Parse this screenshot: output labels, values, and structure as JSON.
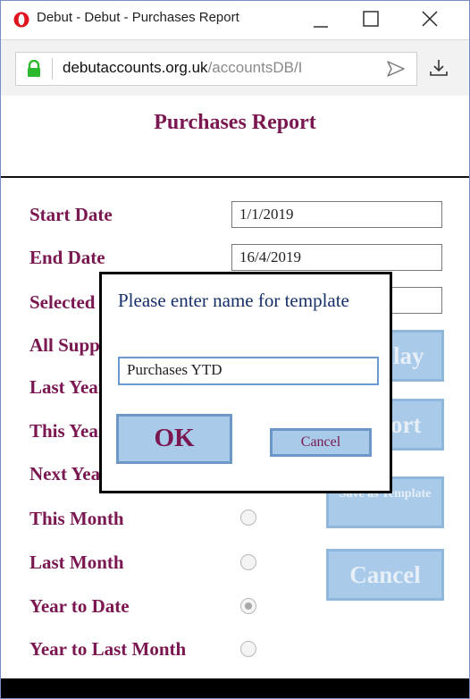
{
  "browser": {
    "title": "Debut - Debut - Purchases Report",
    "url_host": "debutaccounts.org.uk",
    "url_path": "/accountsDB/I",
    "icons": [
      "opera-logo-icon",
      "minimize-icon",
      "maximize-icon",
      "close-icon",
      "lock-icon",
      "send-icon",
      "download-icon"
    ],
    "lock_color": "#2eb82e"
  },
  "page": {
    "title": "Purchases Report",
    "accent_color": "#7a1650",
    "fields": [
      {
        "label": "Start Date",
        "value": "1/1/2019"
      },
      {
        "label": "End Date",
        "value": "16/4/2019"
      },
      {
        "label": "Selected",
        "value": ""
      }
    ],
    "periods": [
      {
        "label": "All Suppliers",
        "checked": false
      },
      {
        "label": "Last Year",
        "checked": false
      },
      {
        "label": "This Year",
        "checked": false
      },
      {
        "label": "Next Year",
        "checked": false
      },
      {
        "label": "This Month",
        "checked": false
      },
      {
        "label": "Last Month",
        "checked": false
      },
      {
        "label": "Year to Date",
        "checked": true
      },
      {
        "label": "Year to Last Month",
        "checked": false
      }
    ],
    "buttons": {
      "display": "Display",
      "export": "Export",
      "save_template": "Save as Template",
      "cancel": "Cancel"
    }
  },
  "dialog": {
    "message": "Please enter name for template",
    "input_value": "Purchases YTD",
    "ok_label": "OK",
    "cancel_label": "Cancel"
  }
}
